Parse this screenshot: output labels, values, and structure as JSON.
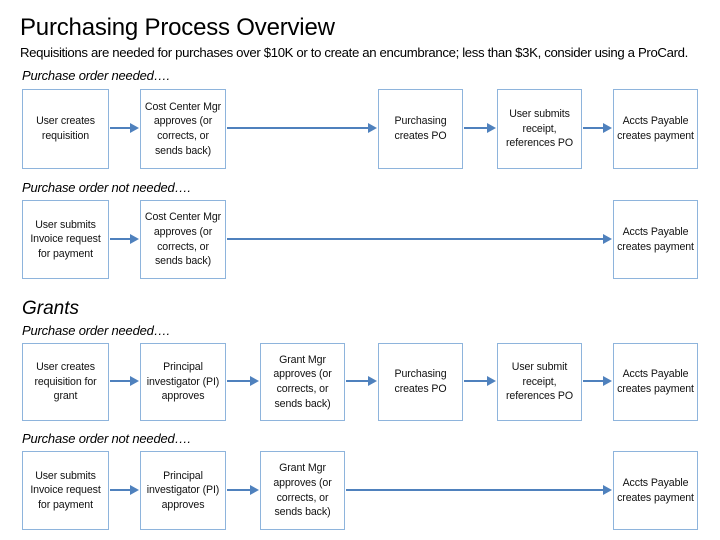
{
  "header": {
    "title": "Purchasing Process Overview",
    "subtitle": "Requisitions are needed for purchases over $10K or to create an encumbrance; less than $3K, consider using a ProCard."
  },
  "sections": [
    {
      "name": "general",
      "heading": "",
      "rows": [
        {
          "caption": "Purchase order needed….",
          "boxes": [
            "User creates requisition",
            "Cost Center Mgr approves (or corrects, or sends back)",
            "Purchasing creates PO",
            "User submits receipt, references PO",
            "Accts Payable creates payment"
          ]
        },
        {
          "caption": "Purchase order not needed….",
          "boxes": [
            "User submits Invoice request  for payment",
            "Cost Center Mgr approves (or corrects, or sends back)",
            "Accts Payable creates payment"
          ]
        }
      ]
    },
    {
      "name": "grants",
      "heading": "Grants",
      "rows": [
        {
          "caption": "Purchase order needed….",
          "boxes": [
            "User creates requisition for grant",
            "Principal investigator (PI) approves",
            "Grant Mgr approves (or corrects, or sends back)",
            "Purchasing creates PO",
            "User submit receipt, references PO",
            "Accts Payable creates payment"
          ]
        },
        {
          "caption": "Purchase order not needed….",
          "boxes": [
            "User submits Invoice request  for payment",
            "Principal investigator (PI) approves",
            "Grant Mgr approves (or corrects, or sends back)",
            "Accts Payable creates payment"
          ]
        }
      ]
    }
  ],
  "colors": {
    "box_border": "#8EB4DC",
    "arrow": "#4F81BD",
    "text": "#000000",
    "background": "#FFFFFF"
  }
}
